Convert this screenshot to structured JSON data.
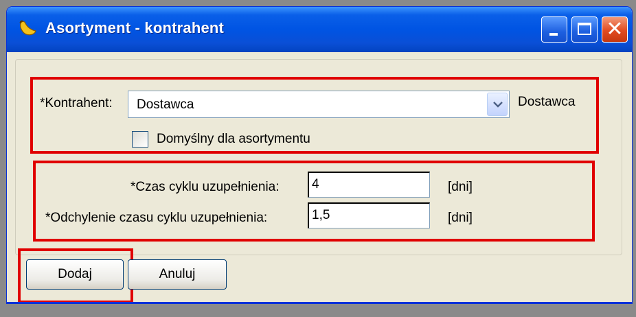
{
  "window": {
    "title": "Asortyment - kontrahent",
    "icon": "banana-icon",
    "controls": {
      "minimize": "minimize-icon",
      "maximize": "maximize-icon",
      "close": "close-icon"
    }
  },
  "contractor": {
    "label": "*Kontrahent:",
    "selected": "Dostawca",
    "side_text": "Dostawca",
    "default_checkbox_label": "Domyślny dla asortymentu",
    "default_checked": false
  },
  "cycle": {
    "time_label": "*Czas cyklu uzupełnienia:",
    "time_value": "4",
    "time_unit": "[dni]",
    "deviation_label": "*Odchylenie czasu cyklu uzupełnienia:",
    "deviation_value": "1,5",
    "deviation_unit": "[dni]"
  },
  "buttons": {
    "add": "Dodaj",
    "cancel": "Anuluj"
  },
  "colors": {
    "highlight": "#e00000",
    "titlebar": "#0054e3",
    "dialog_bg": "#ece9d8"
  }
}
